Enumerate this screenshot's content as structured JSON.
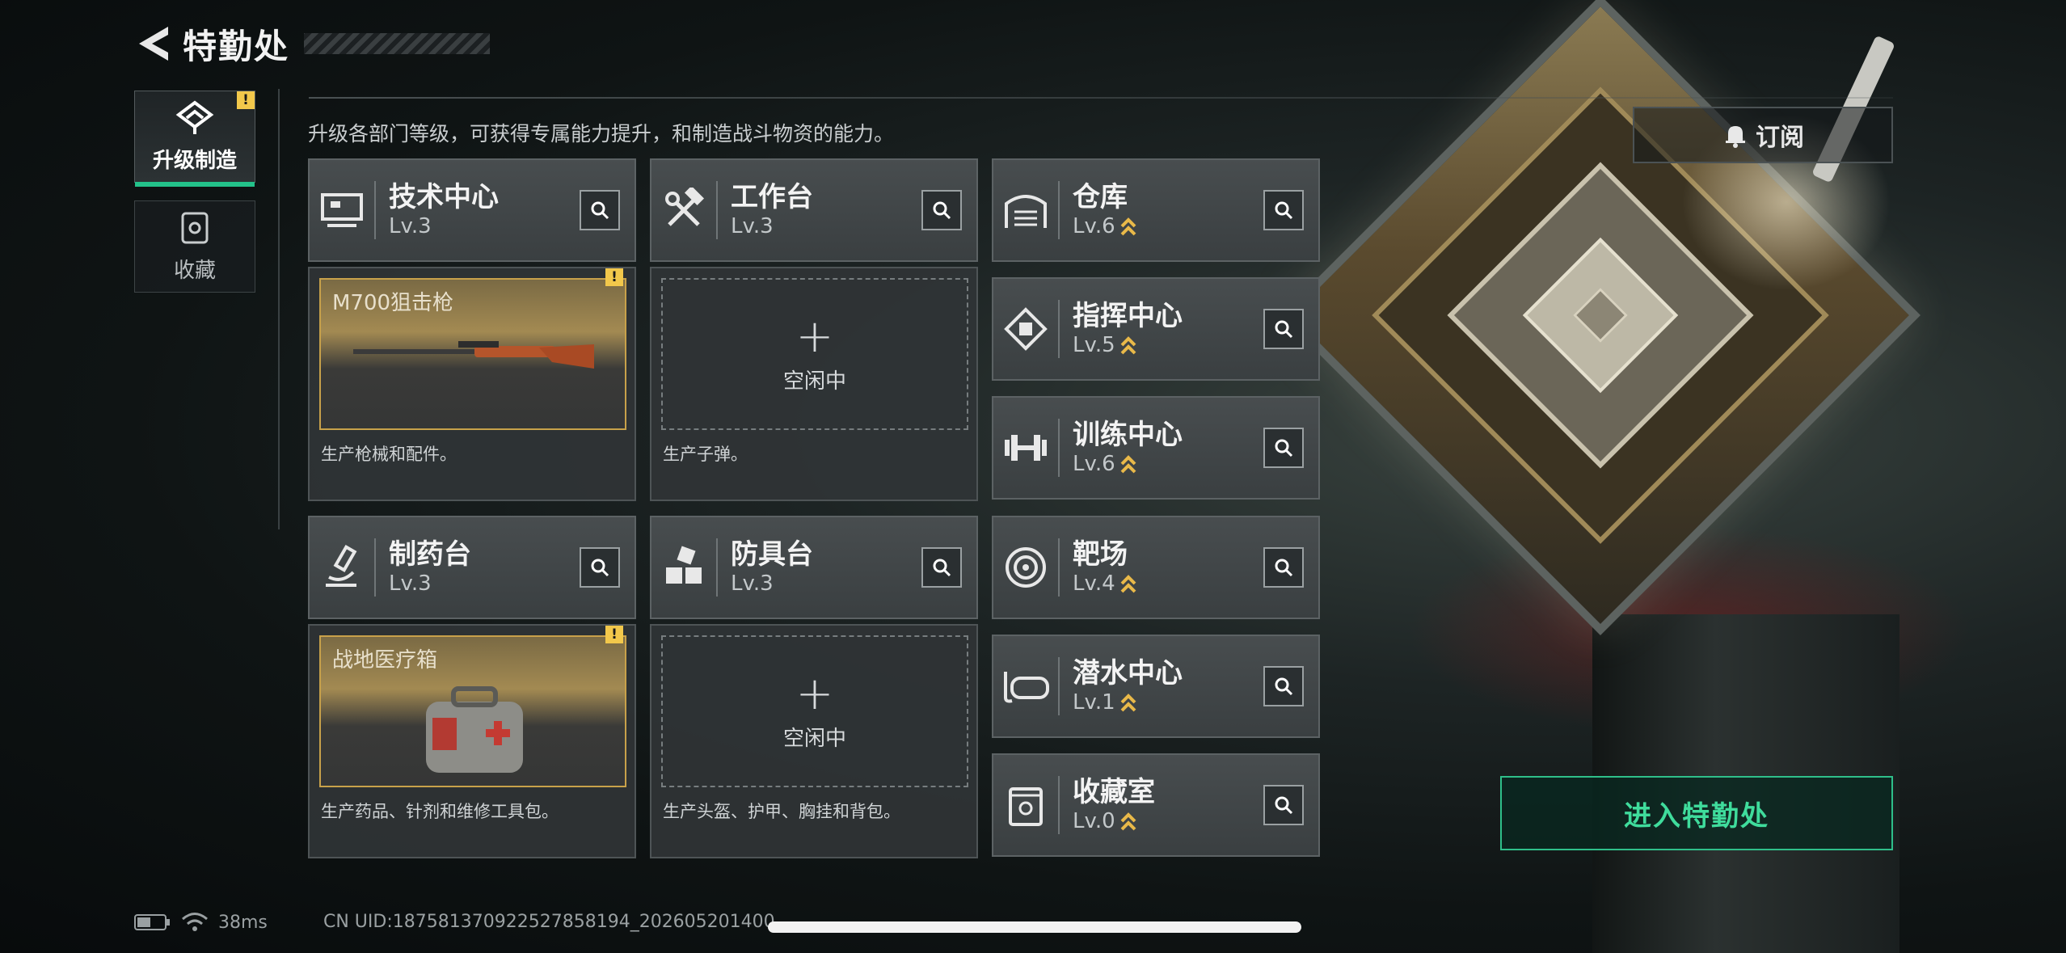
{
  "header": {
    "title": "特勤处"
  },
  "sidebar": {
    "tabs": [
      {
        "label": "升级制造",
        "active": true,
        "badge": "!"
      },
      {
        "label": "收藏",
        "active": false
      }
    ]
  },
  "description": "升级各部门等级，可获得专属能力提升，和制造战斗物资的能力。",
  "departments": {
    "tech_center": {
      "name": "技术中心",
      "level": "Lv.3"
    },
    "workbench": {
      "name": "工作台",
      "level": "Lv.3"
    },
    "pharmacy": {
      "name": "制药台",
      "level": "Lv.3"
    },
    "armor_bench": {
      "name": "防具台",
      "level": "Lv.3"
    },
    "warehouse": {
      "name": "仓库",
      "level": "Lv.6"
    },
    "command_center": {
      "name": "指挥中心",
      "level": "Lv.5"
    },
    "training_center": {
      "name": "训练中心",
      "level": "Lv.6"
    },
    "shooting_range": {
      "name": "靶场",
      "level": "Lv.4"
    },
    "diving_center": {
      "name": "潜水中心",
      "level": "Lv.1"
    },
    "collection_room": {
      "name": "收藏室",
      "level": "Lv.0"
    }
  },
  "production": {
    "tech_center": {
      "item": "M700狙击枪",
      "badge": "!",
      "desc": "生产枪械和配件。"
    },
    "workbench": {
      "plus": "+",
      "status": "空闲中",
      "desc": "生产子弹。"
    },
    "pharmacy": {
      "item": "战地医疗箱",
      "badge": "!",
      "desc": "生产药品、针剂和维修工具包。"
    },
    "armor_bench": {
      "plus": "+",
      "status": "空闲中",
      "desc": "生产头盔、护甲、胸挂和背包。"
    }
  },
  "buttons": {
    "subscribe": "订阅",
    "enter": "进入特勤处"
  },
  "status_bar": {
    "ping": "38ms",
    "uid": "CN UID:187581370922527858194_202605201400"
  },
  "colors": {
    "accent_green": "#23c28a",
    "warning_yellow": "#f2c84b",
    "gold_border": "#c8a14a"
  }
}
